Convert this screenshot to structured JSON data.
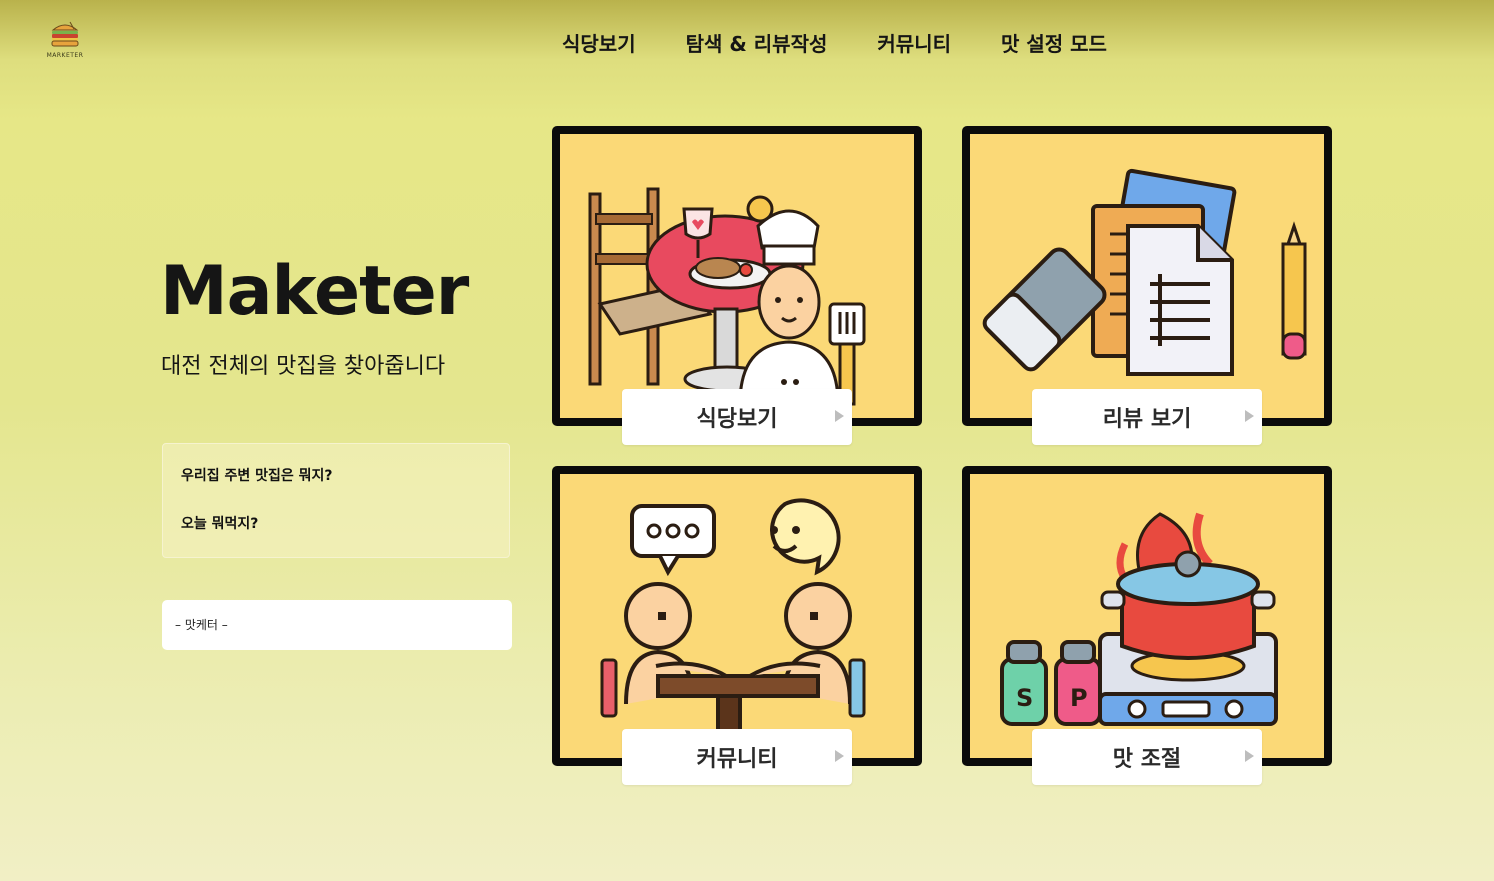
{
  "header": {
    "logo_text": "MARKETER",
    "nav": [
      "식당보기",
      "탐색 & 리뷰작성",
      "커뮤니티",
      "맛 설정 모드"
    ]
  },
  "hero": {
    "title": "Maketer",
    "tagline": "대전 전체의 맛집을 찾아줍니다",
    "quotes": [
      "우리집 주변 맛집은 뭐지?",
      "오늘 뭐먹지?"
    ],
    "signature": "– 맛케터 –"
  },
  "cards": [
    {
      "label": "식당보기",
      "icon": "restaurant-chef-icon"
    },
    {
      "label": "리뷰 보기",
      "icon": "review-documents-icon"
    },
    {
      "label": "커뮤니티",
      "icon": "community-talk-icon"
    },
    {
      "label": "맛 조절",
      "icon": "taste-cooking-pot-icon"
    }
  ],
  "colors": {
    "card_bg": "#fbd977",
    "card_border": "#0b0b0b",
    "accent": "#e9463f"
  }
}
